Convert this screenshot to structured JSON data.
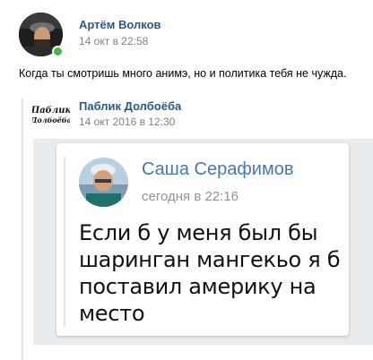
{
  "post": {
    "author": "Артём Волков",
    "time": "14 окт в 22:58",
    "text": "Когда ты смотришь много анимэ, но и политика тебя не чужда."
  },
  "repost": {
    "group_name": "Паблик Долбоёба",
    "group_logo_text_1": "Паблик",
    "group_logo_text_2": "Долбоёба",
    "time": "14 окт 2016 в 12:30"
  },
  "attached_screenshot": {
    "author": "Саша Серафимов",
    "time": "сегодня в 22:16",
    "text_lines": [
      "Если б у меня был бы",
      "шаринган мангекьо я б",
      "поставил америку на",
      "место"
    ]
  },
  "colors": {
    "link": "#2a5885",
    "meta": "#828282",
    "online": "#4bb34b"
  }
}
